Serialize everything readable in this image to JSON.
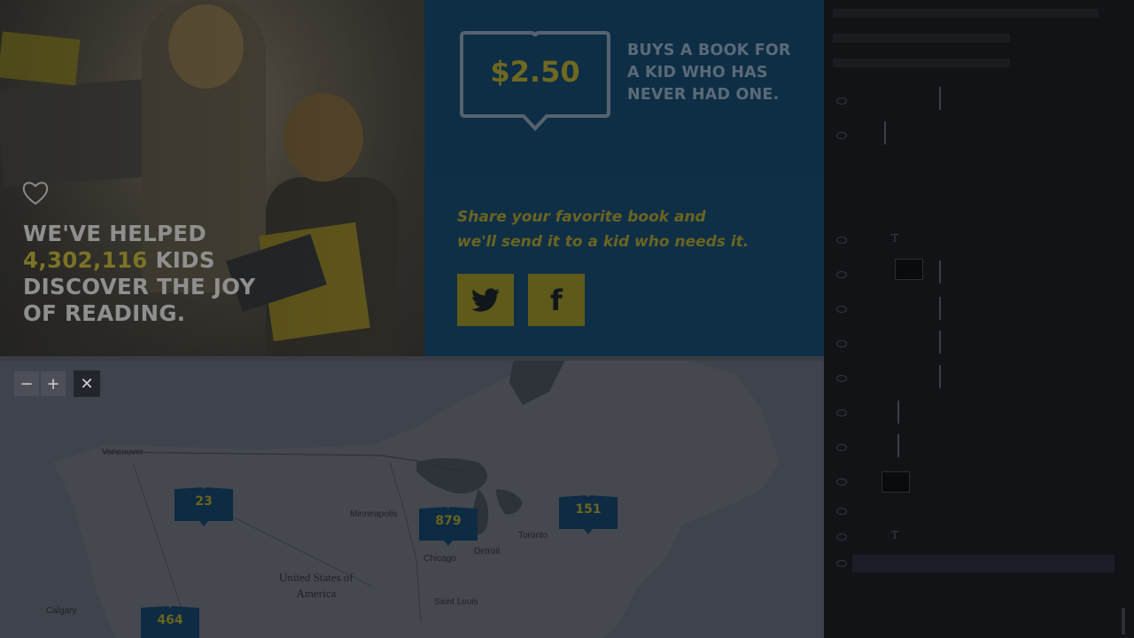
{
  "hero": {
    "line1": "WE'VE HELPED",
    "count": "4,302,116",
    "line2_suffix": " KIDS",
    "line3": "DISCOVER THE JOY",
    "line4": "OF READING."
  },
  "promo": {
    "price": "$2.50",
    "buys_line1": "BUYS A BOOK FOR",
    "buys_line2": "A KID WHO HAS",
    "buys_line3": "NEVER HAD ONE.",
    "share_line1": "Share your favorite book and",
    "share_line2": "we'll send it to a kid who needs it.",
    "twitter_icon": "twitter-icon",
    "facebook_icon": "facebook-icon",
    "facebook_glyph": "f"
  },
  "map": {
    "zoom_out": "−",
    "zoom_in": "+",
    "close": "✕",
    "country_line1": "United States of",
    "country_line2": "America",
    "pins": [
      {
        "value": "23"
      },
      {
        "value": "879"
      },
      {
        "value": "151"
      },
      {
        "value": "464"
      }
    ],
    "cities": [
      "Vancouver",
      "Minneapolis",
      "Chicago",
      "Detroit",
      "Toronto",
      "Saint Louis",
      "Calgary"
    ]
  },
  "colors": {
    "accent_yellow": "#6f6820",
    "promo_blue": "#0f2f46",
    "panel_bg": "#111316"
  }
}
